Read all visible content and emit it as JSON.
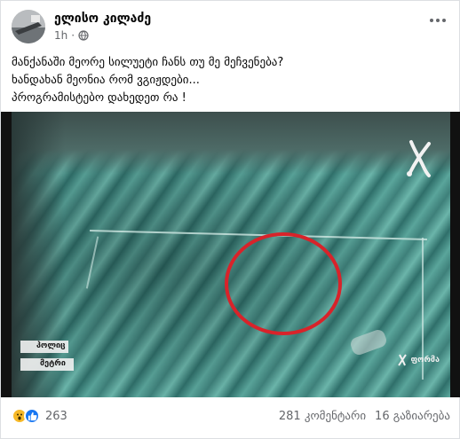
{
  "post": {
    "author": "ელისო კილაძე",
    "time": "1h",
    "dot": "·",
    "privacy_icon": "globe-icon",
    "text_lines": [
      "მანქანაში მეორე სილუეტი ჩანს თუ მე მეჩვენება?",
      "ხანდახან მეონია რომ ვგიჟდები...",
      "პროგრამისტებო დახედეთ რა !"
    ]
  },
  "media": {
    "watermark_left_top": "პოლიც",
    "watermark_left_bottom": "მეტრი",
    "watermark_right": "ფორმა",
    "highlight_color": "#d8232a"
  },
  "footer": {
    "reaction_icons": [
      "wow-icon",
      "like-icon"
    ],
    "reaction_count": "263",
    "comments": "281 კომენტარი",
    "shares": "16 გაზიარება"
  }
}
